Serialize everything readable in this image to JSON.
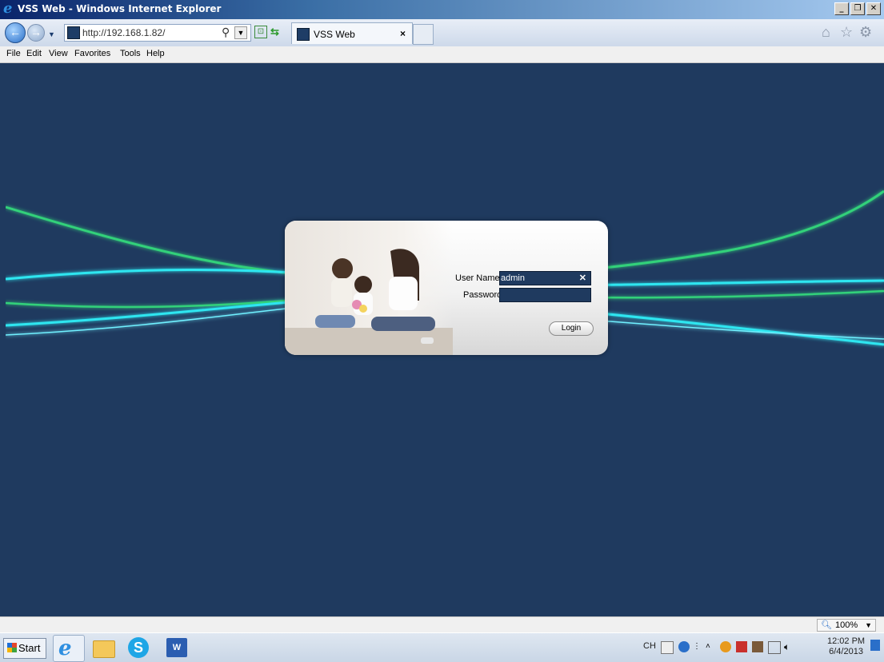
{
  "window": {
    "title": "VSS Web - Windows Internet Explorer"
  },
  "toolbar": {
    "address_url": "http://192.168.1.82/",
    "tab_title": "VSS Web",
    "icons": [
      "back-icon",
      "forward-icon",
      "search-icon",
      "compat-view-icon",
      "refresh-icon",
      "home-icon",
      "favorites-star-icon",
      "tools-gear-icon"
    ]
  },
  "menu": {
    "items": [
      "File",
      "Edit",
      "View",
      "Favorites",
      "Tools",
      "Help"
    ]
  },
  "login": {
    "username_label": "User Name:",
    "username_value": "admin",
    "password_label": "Password:",
    "password_value": "",
    "login_button": "Login"
  },
  "status": {
    "zoom": "100%"
  },
  "taskbar": {
    "start_label": "Start",
    "lang": "CH",
    "time": "12:02 PM",
    "date": "6/4/2013"
  },
  "colors": {
    "page_background": "#1f3a5f",
    "accent_cyan": "#2ee6f0",
    "accent_green": "#33d17a"
  }
}
